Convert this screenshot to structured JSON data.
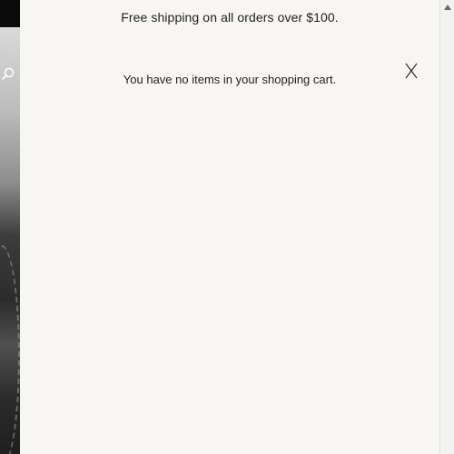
{
  "drawer": {
    "promo_text": "Free shipping on all orders over $100.",
    "empty_message": "You have no items in your shopping cart."
  },
  "icons": {
    "close": "close-icon",
    "search": "search-icon",
    "scroll_up": "chevron-up-icon"
  },
  "colors": {
    "drawer_background": "#f8f6f2",
    "text": "#1f1f1f"
  }
}
